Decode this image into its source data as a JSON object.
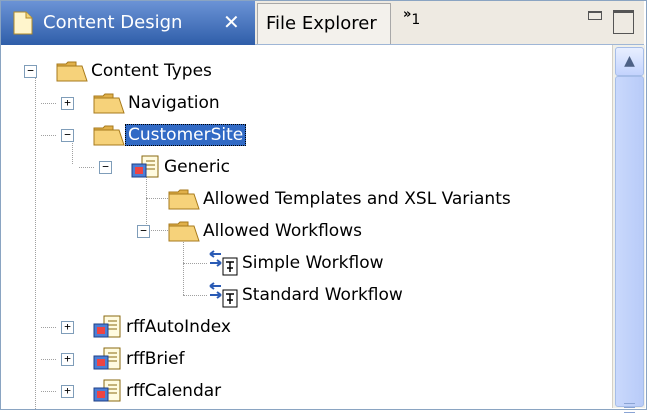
{
  "tabs": {
    "active": {
      "label": "Content Design",
      "close_symbol": "✕"
    },
    "inactive": {
      "label": "File Explorer"
    },
    "overflow": {
      "symbol": "»",
      "count": "1"
    }
  },
  "tree": {
    "root": "Content Types",
    "navigation": "Navigation",
    "customer_site": "CustomerSite",
    "generic": "Generic",
    "allowed_templates": "Allowed Templates and XSL Variants",
    "allowed_workflows": "Allowed Workflows",
    "simple_workflow": "Simple Workflow",
    "standard_workflow": "Standard Workflow",
    "rff_auto_index": "rffAutoIndex",
    "rff_brief": "rffBrief",
    "rff_calendar": "rffCalendar"
  },
  "expanders": {
    "plus": "+",
    "minus": "−"
  },
  "icons": {
    "tab": "document-icon",
    "folder": "folder-open-icon",
    "content_type": "content-type-icon",
    "workflow": "workflow-icon"
  },
  "colors": {
    "selection": "#316ac5",
    "tab_active": "#3d6bb8",
    "folder": "#f2c463"
  }
}
